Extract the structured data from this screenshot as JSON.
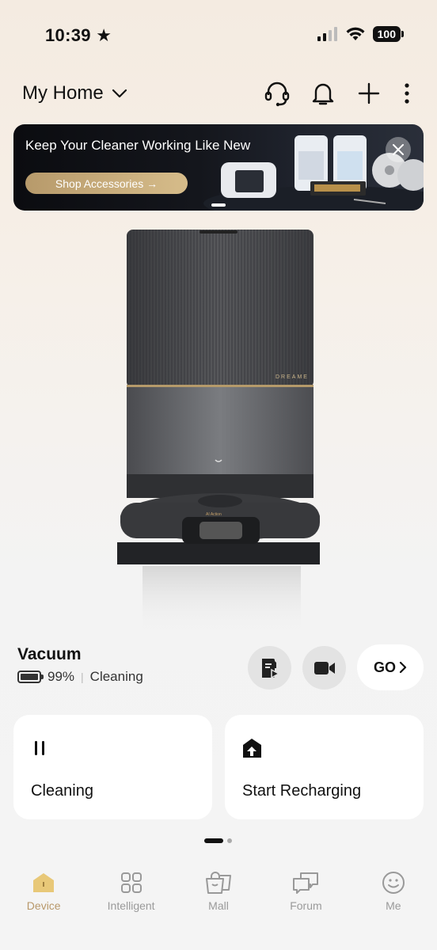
{
  "status_bar": {
    "time": "10:39",
    "battery": "100"
  },
  "header": {
    "title": "My Home"
  },
  "banner": {
    "title": "Keep Your Cleaner Working Like New",
    "button_label": "Shop Accessories →"
  },
  "device": {
    "name": "Vacuum",
    "battery": "99%",
    "state": "Cleaning",
    "go_label": "GO"
  },
  "cards": [
    {
      "label": "Cleaning",
      "icon": "pause-icon"
    },
    {
      "label": "Start Recharging",
      "icon": "recharge-dock-icon"
    }
  ],
  "tabs": [
    {
      "label": "Device",
      "icon": "home-icon",
      "active": true
    },
    {
      "label": "Intelligent",
      "icon": "grid-icon",
      "active": false
    },
    {
      "label": "Mall",
      "icon": "shopping-bag-icon",
      "active": false
    },
    {
      "label": "Forum",
      "icon": "chat-bubbles-icon",
      "active": false
    },
    {
      "label": "Me",
      "icon": "smiley-icon",
      "active": false
    }
  ],
  "colors": {
    "accent": "#b8986a",
    "card_bg": "#ffffff",
    "round_button_bg": "#e3e3e3"
  }
}
